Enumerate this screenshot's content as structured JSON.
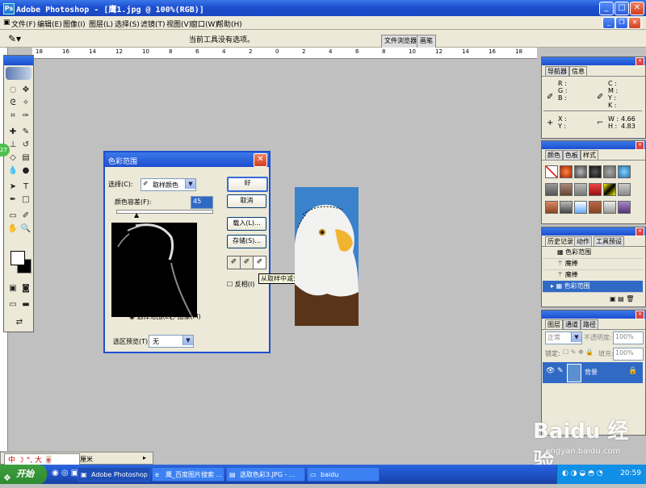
{
  "window": {
    "title": "Adobe Photoshop - [鹰1.jpg @ 100%(RGB)]"
  },
  "menu": [
    "文件(F)",
    "编辑(E)",
    "图像(I)",
    "图层(L)",
    "选择(S)",
    "滤镜(T)",
    "视图(V)",
    "窗口(W)",
    "帮助(H)"
  ],
  "options": {
    "hint": "当前工具没有选项。",
    "file_browser_tab": "文件浏览器",
    "brushes_tab": "画笔"
  },
  "rulers": {
    "h": [
      "18",
      "16",
      "14",
      "12",
      "10",
      "8",
      "6",
      "4",
      "2",
      "0",
      "2",
      "4",
      "6",
      "8",
      "10",
      "12",
      "14",
      "16",
      "18"
    ]
  },
  "dialog": {
    "title": "色彩范围",
    "select_label": "选择(C):",
    "select_value": "取样颜色",
    "fuzziness_label": "颜色容差(F):",
    "fuzziness_value": "45",
    "radio_selection": "选择范围(E)",
    "radio_image": "图像(M)",
    "preview_label": "选区预览(T):",
    "preview_value": "无",
    "ok": "好",
    "cancel": "取消",
    "load": "载入(L)...",
    "save": "存储(S)...",
    "invert": "反相(I)"
  },
  "tooltip": "从取样中减去",
  "navigator": {
    "tabs": [
      "导航器",
      "信息"
    ],
    "rgb": [
      "R :",
      "G :",
      "B :"
    ],
    "cmyk": [
      "C :",
      "M :",
      "Y :",
      "K :"
    ],
    "xy": [
      "X :",
      "Y :"
    ],
    "w_label": "W :",
    "w_value": "4.66",
    "h_label": "H :",
    "h_value": "4.83"
  },
  "swatches_panel": {
    "tabs": [
      "颜色",
      "色板",
      "样式"
    ]
  },
  "history": {
    "tabs": [
      "历史记录",
      "动作",
      "工具预设"
    ],
    "items": [
      "色彩范围",
      "魔棒",
      "魔棒",
      "色彩范围"
    ]
  },
  "layers": {
    "tabs": [
      "图层",
      "通道",
      "路径"
    ],
    "blend": "正常",
    "opacity_label": "不透明度:",
    "opacity_value": "100%",
    "lock_label": "锁定:",
    "fill_label": "填充:",
    "fill_value": "100%",
    "layer_name": "背景"
  },
  "statusbar": {
    "ime": "中 ☽ °, 大 🀄",
    "unit": "厘米"
  },
  "taskbar": {
    "start": "开始",
    "tasks": [
      "Adobe Photoshop ...",
      "鹰_百度图片搜索 ...",
      "选取色彩3.JPG - ...",
      "baidu"
    ],
    "clock": "20:59"
  },
  "watermark": {
    "logo": "Baidu 经验",
    "url": "jingyan.baidu.com"
  },
  "colors": {
    "xp_blue": "#1d4fd0",
    "selection": "#316ac5",
    "canvas": "#c0c0c0"
  }
}
